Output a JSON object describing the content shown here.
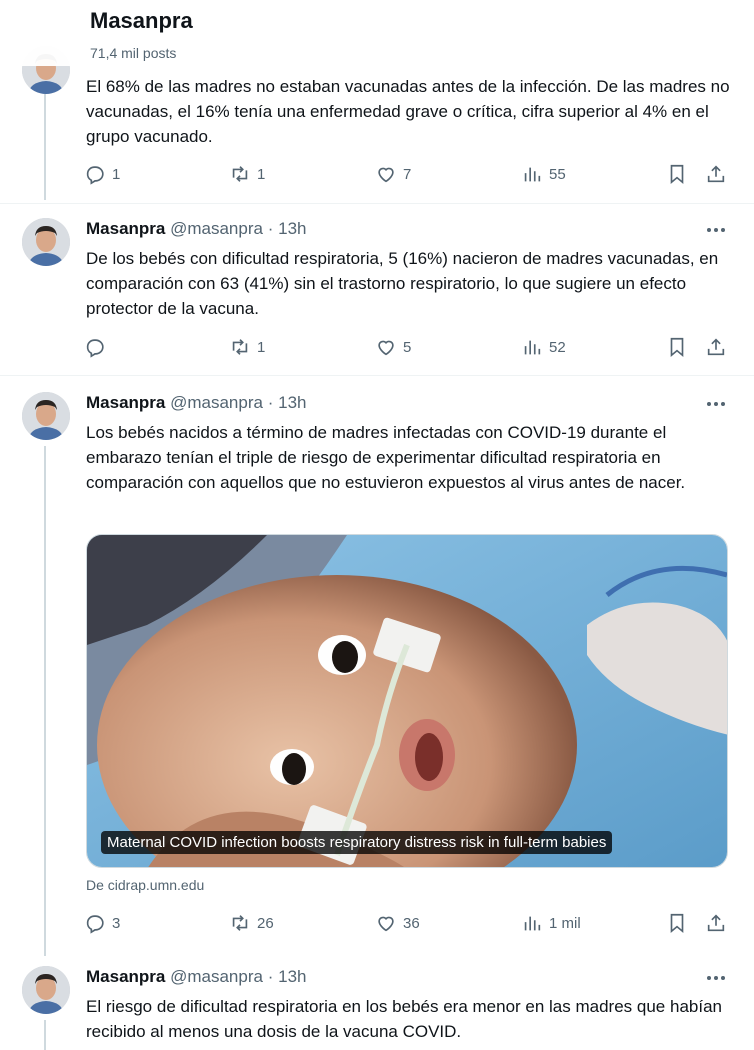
{
  "profile": {
    "name": "Masanpra",
    "posts_count": "71,4 mil posts"
  },
  "tweets": [
    {
      "text": "El 68% de las madres no estaban vacunadas antes de la infección. De las madres no vacunadas, el 16% tenía una enfermedad grave o crítica, cifra superior al 4% en el grupo vacunado.",
      "replies": "1",
      "reposts": "1",
      "likes": "7",
      "views": "55"
    },
    {
      "name": "Masanpra",
      "handle": "@masanpra",
      "dot": "·",
      "time": "13h",
      "text": "De los bebés con dificultad respiratoria, 5 (16%) nacieron de madres vacunadas, en comparación con 63 (41%) sin el trastorno respiratorio, lo que sugiere un efecto protector de la vacuna.",
      "replies": "",
      "reposts": "1",
      "likes": "5",
      "views": "52"
    },
    {
      "name": "Masanpra",
      "handle": "@masanpra",
      "dot": "·",
      "time": "13h",
      "text": "Los bebés nacidos a término de madres infectadas con COVID-19 durante el embarazo tenían el triple de riesgo de experimentar dificultad respiratoria en comparación con aquellos que no estuvieron expuestos al virus antes de nacer.",
      "card_caption": "Maternal COVID infection boosts respiratory distress risk in full-term babies",
      "card_source": "De cidrap.umn.edu",
      "replies": "3",
      "reposts": "26",
      "likes": "36",
      "views": "1 mil"
    },
    {
      "name": "Masanpra",
      "handle": "@masanpra",
      "dot": "·",
      "time": "13h",
      "text": "El riesgo de dificultad respiratoria en los bebés era menor en las madres que habían recibido al menos una dosis de la vacuna COVID."
    }
  ],
  "icons": {
    "reply": "reply-icon",
    "repost": "repost-icon",
    "like": "heart-icon",
    "views": "views-icon",
    "bookmark": "bookmark-icon",
    "share": "share-icon",
    "more": "more-icon"
  },
  "colors": {
    "text": "#0f1419",
    "secondary": "#536471",
    "thread_line": "#cfd9de"
  }
}
